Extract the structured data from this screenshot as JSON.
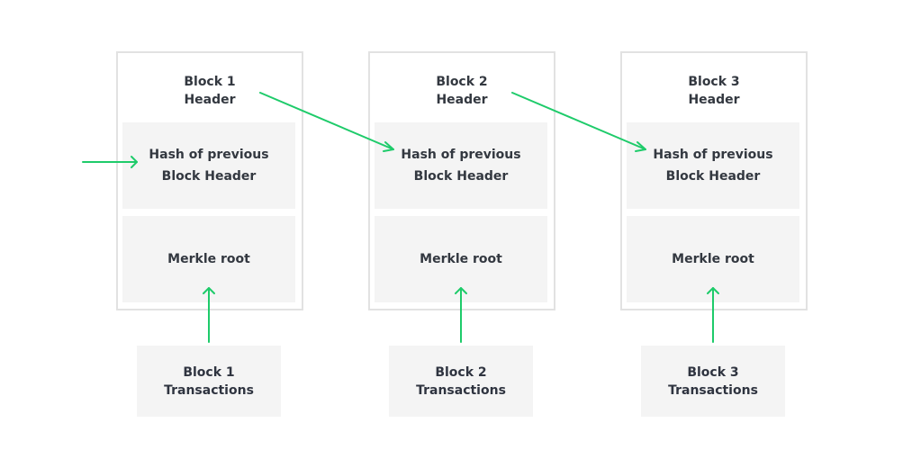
{
  "accent_color": "#1ecb6a",
  "blocks": [
    {
      "header_line1": "Block 1",
      "header_line2": "Header",
      "hash_line1": "Hash of previous",
      "hash_line2": "Block Header",
      "merkle": "Merkle root",
      "tx_line1": "Block 1",
      "tx_line2": "Transactions"
    },
    {
      "header_line1": "Block 2",
      "header_line2": "Header",
      "hash_line1": "Hash of previous",
      "hash_line2": "Block Header",
      "merkle": "Merkle root",
      "tx_line1": "Block 2",
      "tx_line2": "Transactions"
    },
    {
      "header_line1": "Block 3",
      "header_line2": "Header",
      "hash_line1": "Hash of previous",
      "hash_line2": "Block Header",
      "merkle": "Merkle root",
      "tx_line1": "Block 3",
      "tx_line2": "Transactions"
    }
  ],
  "connections": [
    {
      "from": "previous-chain",
      "to": "block-1-hash"
    },
    {
      "from": "block-1-header",
      "to": "block-2-hash"
    },
    {
      "from": "block-2-header",
      "to": "block-3-hash"
    },
    {
      "from": "block-1-transactions",
      "to": "block-1-merkle"
    },
    {
      "from": "block-2-transactions",
      "to": "block-2-merkle"
    },
    {
      "from": "block-3-transactions",
      "to": "block-3-merkle"
    }
  ]
}
